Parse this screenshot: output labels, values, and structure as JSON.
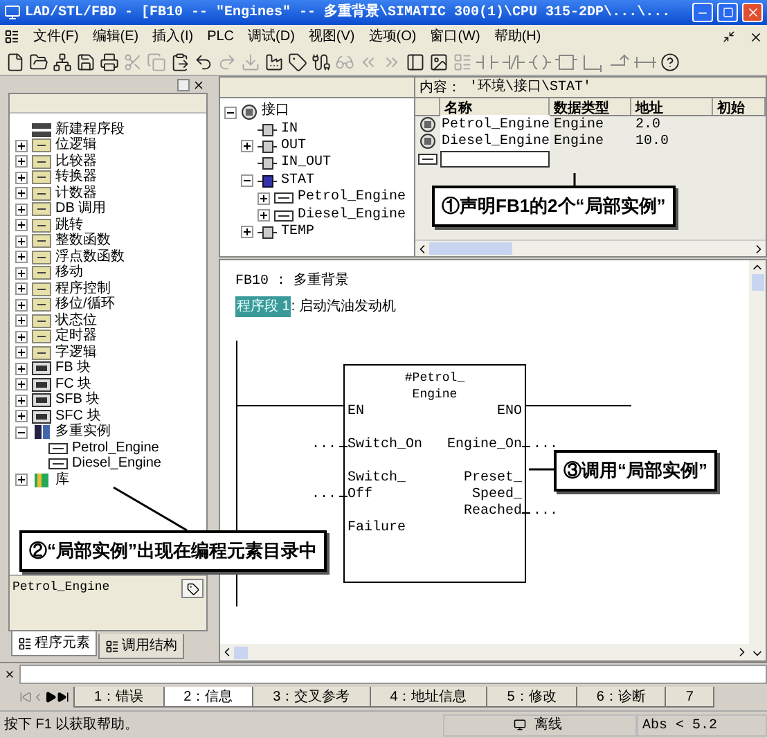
{
  "window": {
    "title": "LAD/STL/FBD  - [FB10 -- \"Engines\" -- 多重背景\\SIMATIC 300(1)\\CPU 315-2DP\\...\\..."
  },
  "menu": [
    "文件(F)",
    "编辑(E)",
    "插入(I)",
    "PLC",
    "调试(D)",
    "视图(V)",
    "选项(O)",
    "窗口(W)",
    "帮助(H)"
  ],
  "toolbar": [
    {
      "kind": "new",
      "disabled": false
    },
    {
      "kind": "open",
      "disabled": false
    },
    {
      "kind": "network",
      "disabled": false
    },
    {
      "kind": "save",
      "disabled": false
    },
    {
      "kind": "print",
      "disabled": false
    },
    {
      "kind": "cut",
      "disabled": true
    },
    {
      "kind": "copy",
      "disabled": true
    },
    {
      "kind": "paste",
      "disabled": false
    },
    {
      "kind": "undo",
      "disabled": false
    },
    {
      "kind": "redo",
      "disabled": true
    },
    {
      "kind": "download",
      "disabled": true
    },
    {
      "kind": "factory",
      "disabled": false
    },
    {
      "kind": "tag",
      "disabled": false
    },
    {
      "kind": "cable",
      "disabled": false
    },
    {
      "kind": "glasses",
      "disabled": true
    },
    {
      "kind": "first",
      "disabled": true
    },
    {
      "kind": "last",
      "disabled": true
    },
    {
      "kind": "panel",
      "disabled": false
    },
    {
      "kind": "image",
      "disabled": false
    },
    {
      "kind": "list",
      "disabled": true
    },
    {
      "kind": "contact",
      "disabled": true
    },
    {
      "kind": "nc-contact",
      "disabled": true
    },
    {
      "kind": "coil",
      "disabled": true
    },
    {
      "kind": "box",
      "disabled": true
    },
    {
      "kind": "branch-open",
      "disabled": true
    },
    {
      "kind": "branch-close",
      "disabled": true
    },
    {
      "kind": "wire",
      "disabled": true
    },
    {
      "kind": "help",
      "disabled": false
    }
  ],
  "elements_panel": {
    "tree": [
      {
        "label": "新建程序段",
        "kind": "network"
      },
      {
        "label": "位逻辑",
        "kind": "category",
        "expanded": false
      },
      {
        "label": "比较器",
        "kind": "category",
        "expanded": false
      },
      {
        "label": "转换器",
        "kind": "category",
        "expanded": false
      },
      {
        "label": "计数器",
        "kind": "category",
        "expanded": false
      },
      {
        "label": "DB 调用",
        "kind": "category",
        "expanded": false
      },
      {
        "label": "跳转",
        "kind": "category",
        "expanded": false
      },
      {
        "label": "整数函数",
        "kind": "category",
        "expanded": false
      },
      {
        "label": "浮点数函数",
        "kind": "category",
        "expanded": false
      },
      {
        "label": "移动",
        "kind": "category",
        "expanded": false
      },
      {
        "label": "程序控制",
        "kind": "category",
        "expanded": false
      },
      {
        "label": "移位/循环",
        "kind": "category",
        "expanded": false
      },
      {
        "label": "状态位",
        "kind": "category",
        "expanded": false
      },
      {
        "label": "定时器",
        "kind": "category",
        "expanded": false
      },
      {
        "label": "字逻辑",
        "kind": "category",
        "expanded": false
      },
      {
        "label": "FB 块",
        "kind": "block",
        "expanded": false
      },
      {
        "label": "FC 块",
        "kind": "block",
        "expanded": false
      },
      {
        "label": "SFB 块",
        "kind": "block",
        "expanded": false
      },
      {
        "label": "SFC 块",
        "kind": "block",
        "expanded": false
      },
      {
        "label": "多重实例",
        "kind": "multi",
        "expanded": true,
        "children": [
          {
            "label": "Petrol_Engine",
            "kind": "instance"
          },
          {
            "label": "Diesel_Engine",
            "kind": "instance"
          }
        ]
      },
      {
        "label": "库",
        "kind": "library",
        "expanded": false
      }
    ],
    "info": "Petrol_Engine",
    "tabs": [
      {
        "label": "程序元素",
        "selected": true
      },
      {
        "label": "调用结构",
        "selected": false
      }
    ]
  },
  "interface": {
    "tree": [
      {
        "label": "接口",
        "kind": "interface",
        "expanded": true,
        "children": [
          {
            "label": "IN",
            "kind": "param"
          },
          {
            "label": "OUT",
            "kind": "param",
            "expanded": false
          },
          {
            "label": "IN_OUT",
            "kind": "param"
          },
          {
            "label": "STAT",
            "kind": "stat",
            "expanded": true,
            "children": [
              {
                "label": "Petrol_Engine",
                "kind": "instance",
                "expanded": false
              },
              {
                "label": "Diesel_Engine",
                "kind": "instance",
                "expanded": false
              }
            ]
          },
          {
            "label": "TEMP",
            "kind": "param",
            "expanded": false
          }
        ]
      }
    ],
    "content_label": "内容：",
    "content_path": "'环境\\接口\\STAT'",
    "columns": [
      "名称",
      "数据类型",
      "地址",
      "初始"
    ],
    "rows": [
      {
        "name": "Petrol_Engine",
        "type": "Engine",
        "address": "2.0"
      },
      {
        "name": "Diesel_Engine",
        "type": "Engine",
        "address": "10.0"
      }
    ]
  },
  "editor": {
    "block_title": "FB10 : 多重背景",
    "network_label": "程序段 1",
    "network_title": ": 启动汽油发动机",
    "instance_lines": [
      "#Petrol_",
      "Engine"
    ],
    "inputs": [
      {
        "kind": "power",
        "lines": [
          "EN"
        ]
      },
      {
        "kind": "param",
        "lines": [
          "Switch_On"
        ],
        "wire": "..."
      },
      {
        "kind": "param",
        "lines": [
          "Switch_",
          "Off"
        ],
        "wire": "..."
      },
      {
        "kind": "param",
        "lines": [
          "Failure"
        ]
      }
    ],
    "outputs": [
      {
        "kind": "power",
        "lines": [
          "ENO"
        ]
      },
      {
        "kind": "param",
        "lines": [
          "Engine_On"
        ],
        "wire": "..."
      },
      {
        "kind": "param",
        "lines": [
          "Preset_",
          "Speed_",
          "Reached"
        ],
        "wire": "..."
      }
    ]
  },
  "callouts": [
    "①声明FB1的2个“局部实例”",
    "②“局部实例”出现在编程元素目录中",
    "③调用“局部实例”"
  ],
  "output": {
    "tabs": [
      {
        "label": "1：错误",
        "selected": false
      },
      {
        "label": "2：信息",
        "selected": true
      },
      {
        "label": "3：交叉参考",
        "selected": false
      },
      {
        "label": "4：地址信息",
        "selected": false
      },
      {
        "label": "5：修改",
        "selected": false
      },
      {
        "label": "6：诊断",
        "selected": false
      },
      {
        "label": "7",
        "selected": false
      }
    ]
  },
  "status_bar": {
    "help": "按下 F1 以获取帮助。",
    "mode": "离线",
    "position": "Abs < 5.2"
  }
}
